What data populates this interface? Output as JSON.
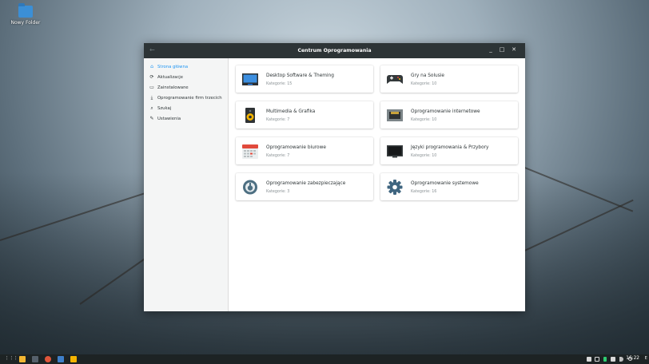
{
  "desktop": {
    "folder_label": "Nowy Folder"
  },
  "window": {
    "title": "Centrum Oprogramowania",
    "back": "←",
    "minimize": "_",
    "maximize": "□",
    "close": "✕"
  },
  "sidebar": {
    "items": [
      {
        "label": "Strona główna",
        "icon": "home-icon",
        "glyph": "⌂"
      },
      {
        "label": "Aktualizacje",
        "icon": "updates-icon",
        "glyph": "⟳"
      },
      {
        "label": "Zainstalowane",
        "icon": "monitor-icon",
        "glyph": "▭"
      },
      {
        "label": "Oprogramowanie firm trzecich",
        "icon": "download-icon",
        "glyph": "⤓"
      },
      {
        "label": "Szukaj",
        "icon": "search-icon",
        "glyph": "⌕"
      },
      {
        "label": "Ustawienia",
        "icon": "settings-icon",
        "glyph": "✎"
      }
    ]
  },
  "categories": [
    {
      "name": "Desktop Software & Theming",
      "count": "Kategorie: 15",
      "icon": "desktop-icon"
    },
    {
      "name": "Gry na Solusie",
      "count": "Kategorie: 10",
      "icon": "gamepad-icon"
    },
    {
      "name": "Multimedia & Grafika",
      "count": "Kategorie: 7",
      "icon": "speaker-icon"
    },
    {
      "name": "Oprogramowanie internetowe",
      "count": "Kategorie: 10",
      "icon": "network-icon"
    },
    {
      "name": "Oprogramowanie biurowe",
      "count": "Kategorie: 7",
      "icon": "calendar-icon"
    },
    {
      "name": "Języki programowania & Przybory",
      "count": "Kategorie: 10",
      "icon": "terminal-icon"
    },
    {
      "name": "Oprogramowanie zabezpieczające",
      "count": "Kategorie: 3",
      "icon": "security-icon"
    },
    {
      "name": "Oprogramowanie systemowe",
      "count": "Kategorie: 16",
      "icon": "gear-icon"
    }
  ],
  "taskbar": {
    "menu_glyph": "⋮⋮⋮",
    "clock": "16:22",
    "end_glyph": "E"
  },
  "colors": {
    "accent": "#2196f3",
    "titlebar": "#2d3436",
    "taskbar": "#1d2324"
  }
}
